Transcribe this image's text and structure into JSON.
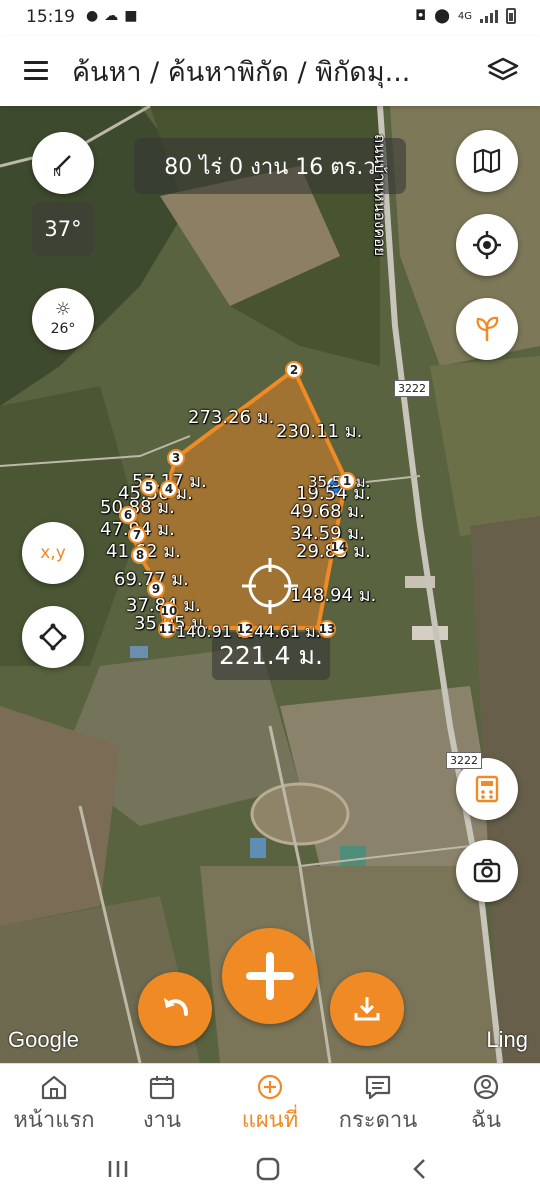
{
  "status_bar": {
    "time": "15:19",
    "network": "4G"
  },
  "header": {
    "breadcrumb": "ค้นหา / ค้นหาพิกัด / พิกัดมุ...",
    "menu_icon": "hamburger-menu-icon",
    "layers_icon": "layers-icon"
  },
  "map": {
    "area": "80 ไร่ 0 งาน 16 ตร.ว",
    "bearing": "37°",
    "sun_angle": "26°",
    "perimeter": "221.4 ม.",
    "road_name": "ถนนบ้านหนองคอย",
    "road_numbers": [
      "3222",
      "3222"
    ],
    "side_lengths": [
      "273.26 ม.",
      "230.11 ม.",
      "57.17 ม.",
      "45.56 ม.",
      "50.88 ม.",
      "47.94 ม.",
      "41.62 ม.",
      "69.77 ม.",
      "37.84 ม.",
      "35.05 ม.",
      "140.91 ม.",
      "244.61 ม.",
      "148.94 ม.",
      "29.85 ม.",
      "34.59 ม.",
      "49.68 ม.",
      "19.54 ม.",
      "35.54 ม."
    ],
    "vertex_labels": [
      "1",
      "2",
      "3",
      "4",
      "5",
      "6",
      "7",
      "8",
      "9",
      "10",
      "11",
      "12",
      "13",
      "14"
    ],
    "coord_button_label": "x,y",
    "attribution_left": "Google",
    "attribution_right": "Ling",
    "polygon_color": "#f08a24"
  },
  "bottom_nav": {
    "items": [
      {
        "label": "หน้าแรก",
        "icon": "home-icon"
      },
      {
        "label": "งาน",
        "icon": "calendar-icon"
      },
      {
        "label": "แผนที่",
        "icon": "add-circle-icon"
      },
      {
        "label": "กระดาน",
        "icon": "board-icon"
      },
      {
        "label": "ฉัน",
        "icon": "profile-icon"
      }
    ],
    "active": "แผนที่"
  },
  "colors": {
    "accent": "#f08a24"
  }
}
